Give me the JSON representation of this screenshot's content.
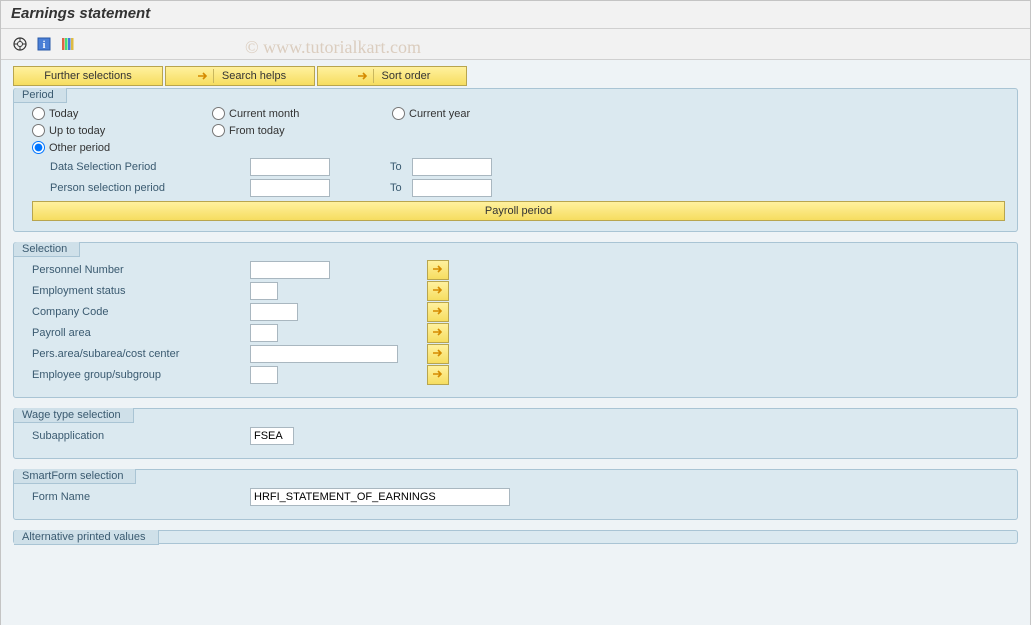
{
  "title": "Earnings statement",
  "watermark": "© www.tutorialkart.com",
  "toolbarButtons": {
    "furtherSelections": "Further selections",
    "searchHelps": "Search helps",
    "sortOrder": "Sort order"
  },
  "period": {
    "title": "Period",
    "radios": {
      "today": "Today",
      "currentMonth": "Current month",
      "currentYear": "Current year",
      "upToToday": "Up to today",
      "fromToday": "From today",
      "otherPeriod": "Other period"
    },
    "dataSelectionLabel": "Data Selection Period",
    "personSelectionLabel": "Person selection period",
    "toLabel": "To",
    "payrollPeriodBtn": "Payroll period",
    "values": {
      "dataFrom": "",
      "dataTo": "",
      "personFrom": "",
      "personTo": ""
    }
  },
  "selection": {
    "title": "Selection",
    "rows": [
      {
        "label": "Personnel Number",
        "width": "w80",
        "value": ""
      },
      {
        "label": "Employment status",
        "width": "w30",
        "value": ""
      },
      {
        "label": "Company Code",
        "width": "w50",
        "value": ""
      },
      {
        "label": "Payroll area",
        "width": "w30",
        "value": ""
      },
      {
        "label": "Pers.area/subarea/cost center",
        "width": "w130",
        "value": ""
      },
      {
        "label": "Employee group/subgroup",
        "width": "w30",
        "value": ""
      }
    ]
  },
  "wageType": {
    "title": "Wage type selection",
    "subappLabel": "Subapplication",
    "subappValue": "FSEA"
  },
  "smartForm": {
    "title": "SmartForm selection",
    "formNameLabel": "Form Name",
    "formNameValue": "HRFI_STATEMENT_OF_EARNINGS"
  },
  "altPrinted": {
    "title": "Alternative printed values"
  }
}
